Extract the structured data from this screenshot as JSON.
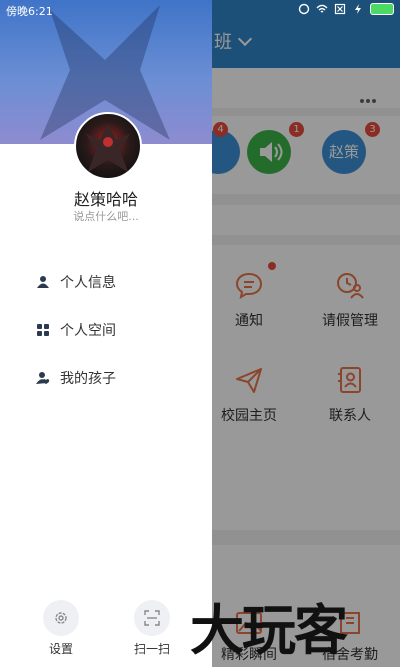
{
  "status_bar": {
    "time": "傍晚6:21"
  },
  "background_app": {
    "header_title": "班",
    "top_badges": [
      "4",
      "1",
      "3"
    ],
    "top_circle_label": "赵策",
    "grid": [
      {
        "label": "通知",
        "icon": "chat-bubble-icon",
        "has_dot": true
      },
      {
        "label": "请假管理",
        "icon": "clock-person-icon",
        "has_dot": false
      },
      {
        "label": "校园主页",
        "icon": "paper-plane-icon",
        "has_dot": false
      },
      {
        "label": "联系人",
        "icon": "contact-book-icon",
        "has_dot": false
      }
    ],
    "bottom_grid": [
      {
        "label": "精彩瞬间"
      },
      {
        "label": "宿舍考勤"
      }
    ]
  },
  "drawer": {
    "user_name": "赵策哈哈",
    "signature": "说点什么吧...",
    "menu": [
      {
        "label": "个人信息",
        "icon": "person-icon"
      },
      {
        "label": "个人空间",
        "icon": "grid-icon"
      },
      {
        "label": "我的孩子",
        "icon": "child-icon"
      }
    ],
    "bottom": {
      "settings_label": "设置",
      "scan_label": "扫一扫"
    }
  },
  "watermark": "大玩客",
  "colors": {
    "header": "#2f86c9",
    "accent": "#e8744a",
    "badge": "#e84c3d"
  }
}
